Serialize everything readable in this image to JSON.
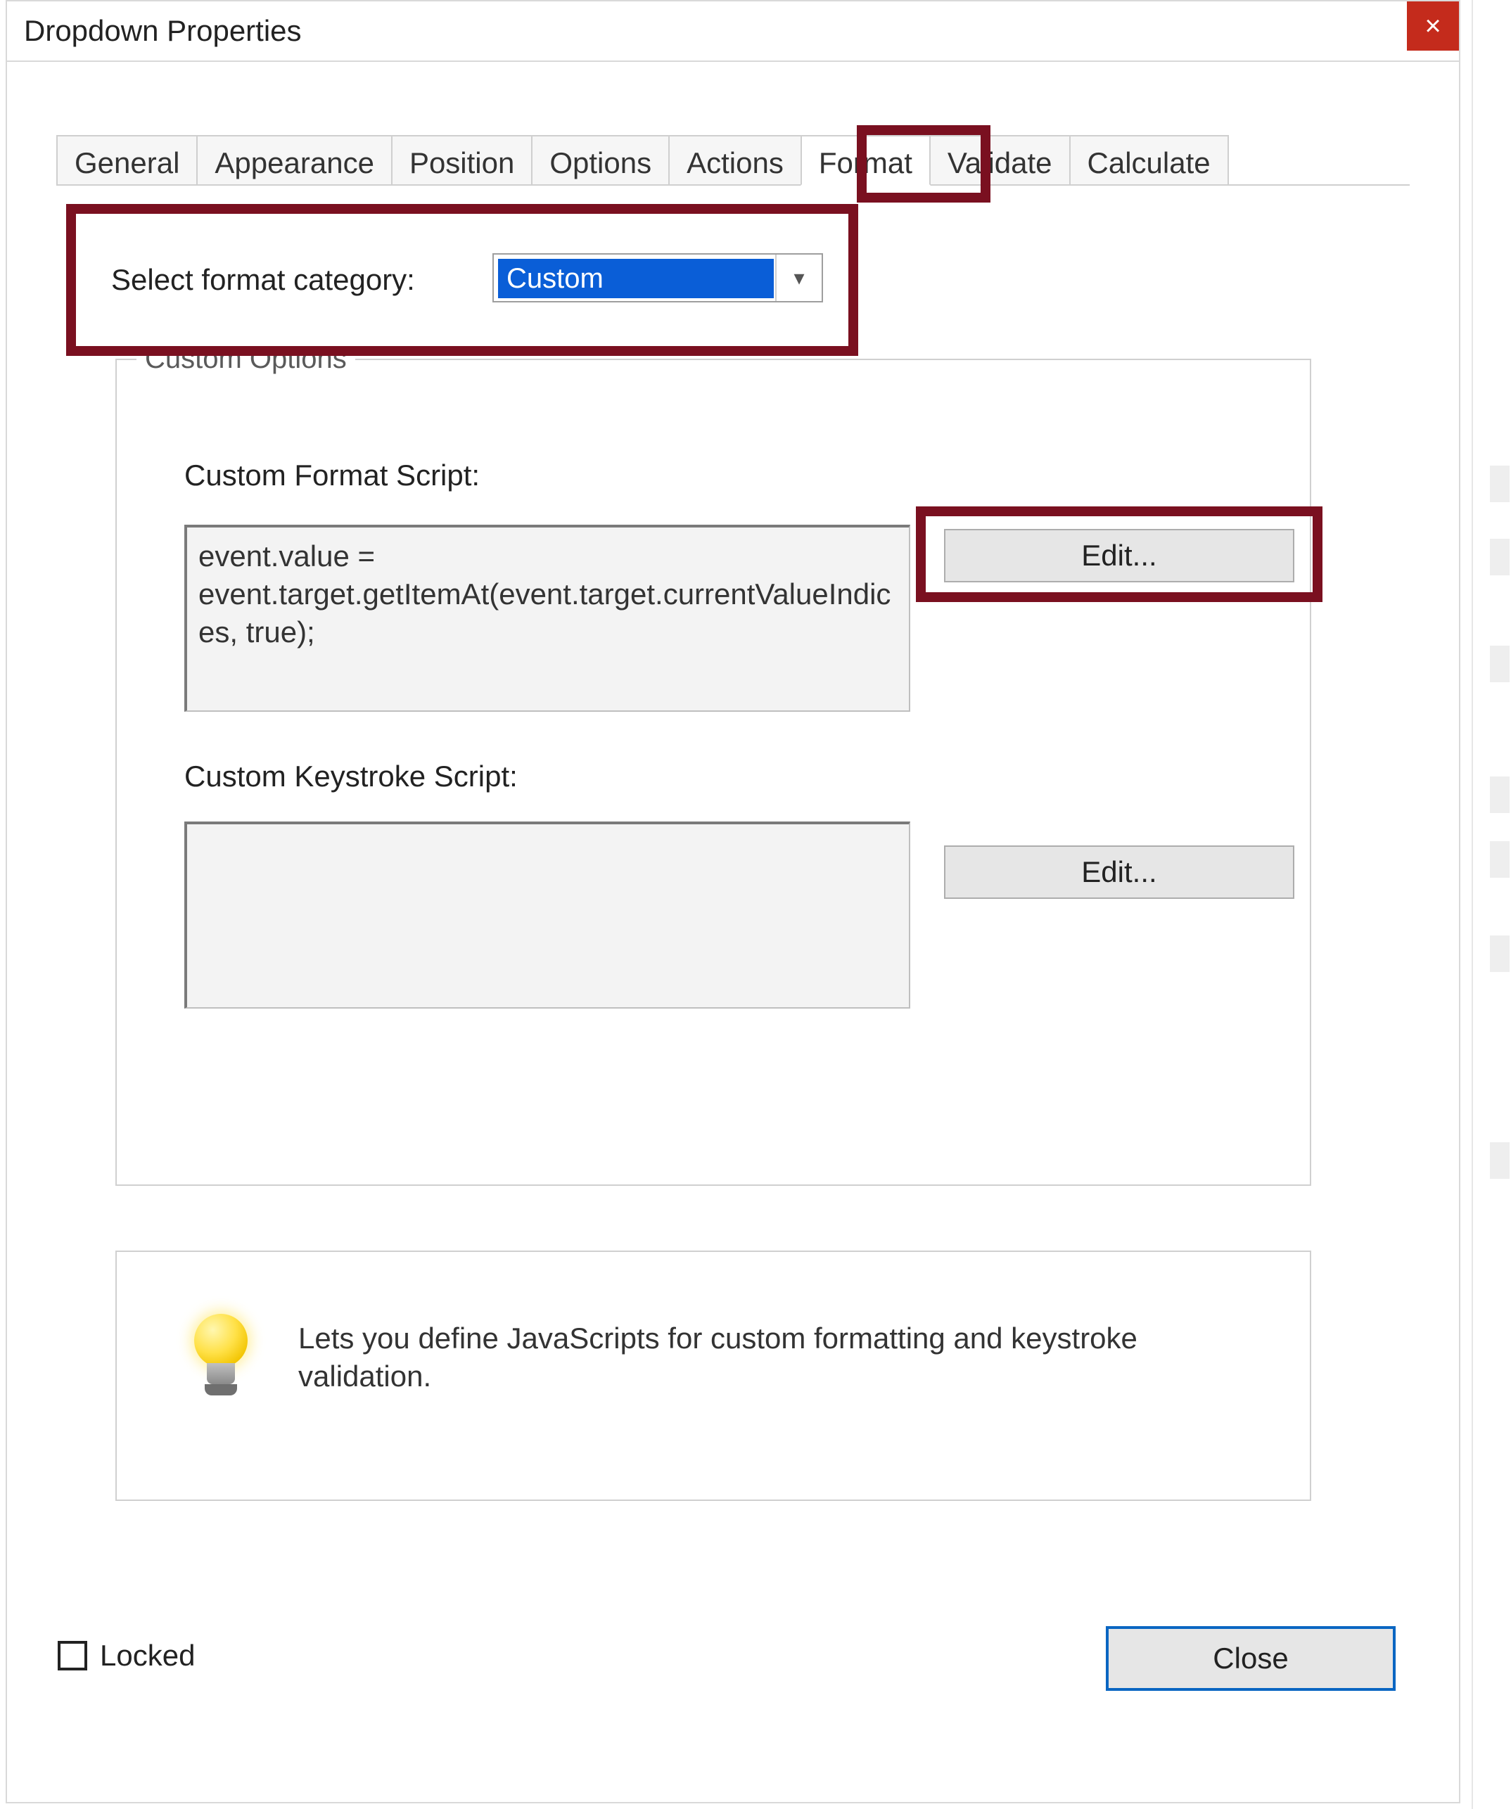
{
  "window": {
    "title": "Dropdown Properties",
    "close_x": "×"
  },
  "tabs": {
    "general": "General",
    "appearance": "Appearance",
    "position": "Position",
    "options": "Options",
    "actions": "Actions",
    "format": "Format",
    "validate": "Validate",
    "calculate": "Calculate",
    "active": "format"
  },
  "format": {
    "category_label": "Select format category:",
    "category_value": "Custom",
    "group_title": "Custom Options",
    "format_script_label": "Custom Format Script:",
    "format_script_value": "event.value =\nevent.target.getItemAt(event.target.currentValueIndices, true);",
    "edit1_label": "Edit...",
    "keystroke_script_label": "Custom Keystroke Script:",
    "keystroke_script_value": "",
    "edit2_label": "Edit...",
    "info_text": "Lets you define JavaScripts for custom formatting and keystroke validation."
  },
  "footer": {
    "locked_label": "Locked",
    "locked_checked": false,
    "close_label": "Close"
  }
}
